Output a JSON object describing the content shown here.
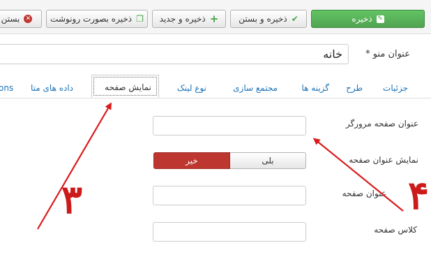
{
  "toolbar": {
    "save_label": "ذخیره",
    "save_close_label": "ذخیره و بستن",
    "save_new_label": "ذخیره و جدید",
    "save_copy_label": "ذخیره بصورت رونوشت",
    "close_label": "بستن"
  },
  "menu_title": {
    "label": "عنوان منو",
    "required_mark": "*",
    "value": "خانه"
  },
  "tabs": [
    {
      "label": "جزئیات"
    },
    {
      "label": "طرح"
    },
    {
      "label": "گزینه ها"
    },
    {
      "label": "مجتمع سازی"
    },
    {
      "label": "نوع لینک"
    },
    {
      "label": "نمایش صفحه"
    },
    {
      "label": "داده های متا"
    },
    {
      "label": "ons"
    }
  ],
  "form": {
    "browser_title_label": "عنوان صفحه مرورگر",
    "browser_title_value": "",
    "show_page_heading_label": "نمایش عنوان صفحه",
    "yes_label": "بلی",
    "no_label": "خیر",
    "selected": "no",
    "page_heading_label": "عنوان صفحه",
    "page_heading_value": "",
    "page_class_label": "کلاس صفحه",
    "page_class_value": ""
  },
  "annotations": {
    "number_left": "۳",
    "number_right": "۴",
    "color": "#cc1b1b"
  },
  "colors": {
    "primary_green": "#51a351",
    "danger_red": "#bd362f",
    "link_blue": "#1a72b8"
  }
}
